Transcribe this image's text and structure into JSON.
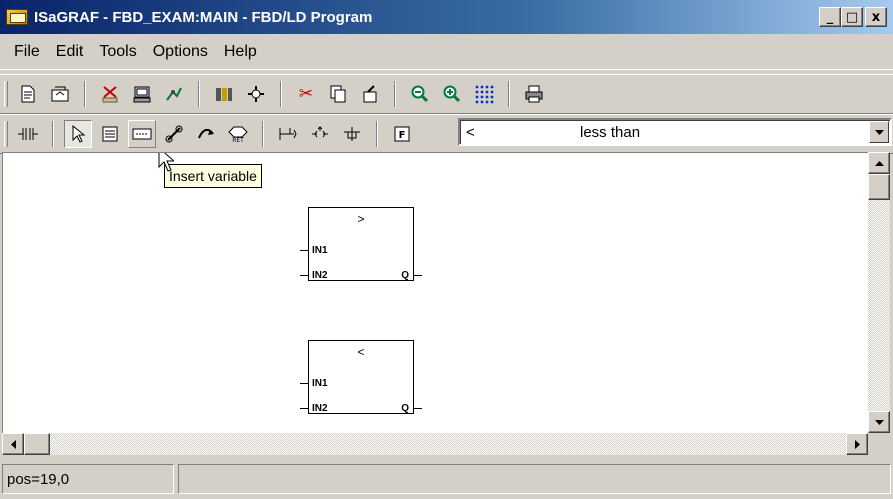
{
  "window": {
    "title": "ISaGRAF - FBD_EXAM:MAIN - FBD/LD Program",
    "minimize": "_",
    "maximize": "□",
    "close": "x"
  },
  "menu": [
    "File",
    "Edit",
    "Tools",
    "Options",
    "Help"
  ],
  "toolbar_main": {
    "icons": [
      "new-page-icon",
      "open-icon",
      "cut-variable-icon",
      "dictionary-icon",
      "compile-icon",
      "library-icon",
      "connect-icon",
      "cut-icon",
      "copy-icon",
      "paste-icon",
      "zoom-out-icon",
      "zoom-in-icon",
      "grid-icon",
      "print-icon"
    ]
  },
  "toolbar_fbd": {
    "icons": [
      "contact-icon",
      "select-icon",
      "insert-block-icon",
      "insert-variable-icon",
      "link-icon",
      "jump-icon",
      "return-icon",
      "rung-icon",
      "coil-icon",
      "branch-icon",
      "function-icon"
    ]
  },
  "block_selector": {
    "operator": "<",
    "description": "less than"
  },
  "tooltip": "Insert variable",
  "blocks": [
    {
      "operator": ">",
      "in1": "IN1",
      "in2": "IN2",
      "out": "Q"
    },
    {
      "operator": "<",
      "in1": "IN1",
      "in2": "IN2",
      "out": "Q"
    }
  ],
  "status": {
    "position": "pos=19,0",
    "message": ""
  }
}
